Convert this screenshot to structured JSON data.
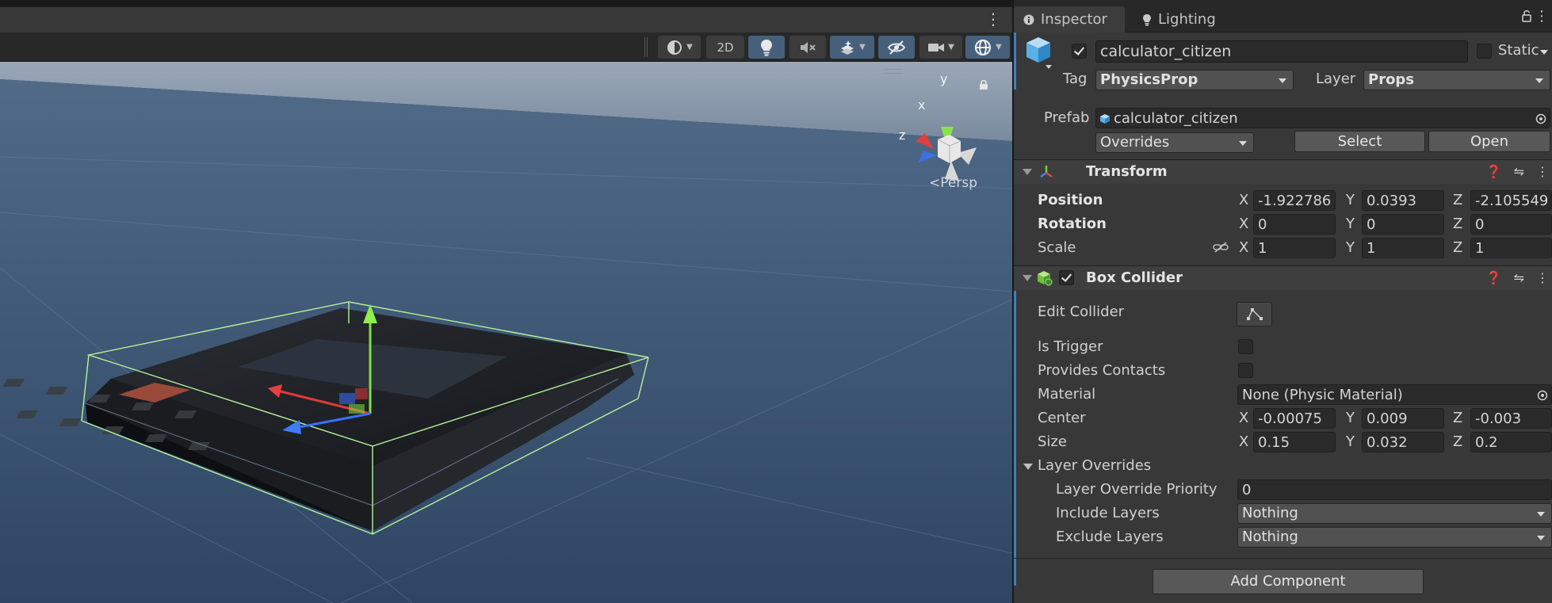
{
  "scene": {
    "toolbar": {
      "btn_2d": "2D",
      "menu_glyph": "⋮",
      "icons": [
        "draw-mode-icon",
        "lightbulb-icon",
        "audio-mute-icon",
        "effects-layers-icon",
        "hidden-eye-icon",
        "camera-icon",
        "gizmos-icon"
      ]
    },
    "gizmo": {
      "x_label": "x",
      "y_label": "y",
      "z_label": "z",
      "projection_label": "Persp"
    }
  },
  "inspector": {
    "tabs": [
      {
        "label": "Inspector",
        "icon": "info-icon",
        "active": true
      },
      {
        "label": "Lighting",
        "icon": "lightbulb-icon",
        "active": false
      }
    ],
    "menu_glyph": "⋮",
    "object": {
      "name": "calculator_citizen",
      "active": true,
      "static_label": "Static",
      "static": false,
      "tag_label": "Tag",
      "tag": "PhysicsProp",
      "layer_label": "Layer",
      "layer": "Props",
      "prefab_label": "Prefab",
      "prefab": "calculator_citizen",
      "overrides": "Overrides",
      "select_label": "Select",
      "open_label": "Open"
    },
    "transform": {
      "title": "Transform",
      "rows": [
        {
          "label": "Position",
          "x": "-1.922786",
          "y": "0.0393",
          "z": "-2.105549",
          "bold": true
        },
        {
          "label": "Rotation",
          "x": "0",
          "y": "0",
          "z": "0",
          "bold": true
        },
        {
          "label": "Scale",
          "x": "1",
          "y": "1",
          "z": "1",
          "bold": false
        }
      ]
    },
    "box_collider": {
      "title": "Box Collider",
      "enabled": true,
      "edit_collider_label": "Edit Collider",
      "is_trigger_label": "Is Trigger",
      "is_trigger": false,
      "provides_contacts_label": "Provides Contacts",
      "provides_contacts": false,
      "material_label": "Material",
      "material": "None (Physic Material)",
      "center_label": "Center",
      "center": {
        "x": "-0.00075",
        "y": "0.009",
        "z": "-0.003"
      },
      "size_label": "Size",
      "size": {
        "x": "0.15",
        "y": "0.032",
        "z": "0.2"
      },
      "layer_overrides_label": "Layer Overrides",
      "priority_label": "Layer Override Priority",
      "priority": "0",
      "include_label": "Include Layers",
      "include": "Nothing",
      "exclude_label": "Exclude Layers",
      "exclude": "Nothing"
    },
    "axis_labels": {
      "x": "X",
      "y": "Y",
      "z": "Z"
    },
    "add_component_label": "Add Component"
  },
  "colors": {
    "selection_blue": "#3f7fbf",
    "toolbar_active": "#46607c",
    "bounds_green": "#b8f29a",
    "sky": "#7e8fa3",
    "ground": "#3d5776"
  }
}
